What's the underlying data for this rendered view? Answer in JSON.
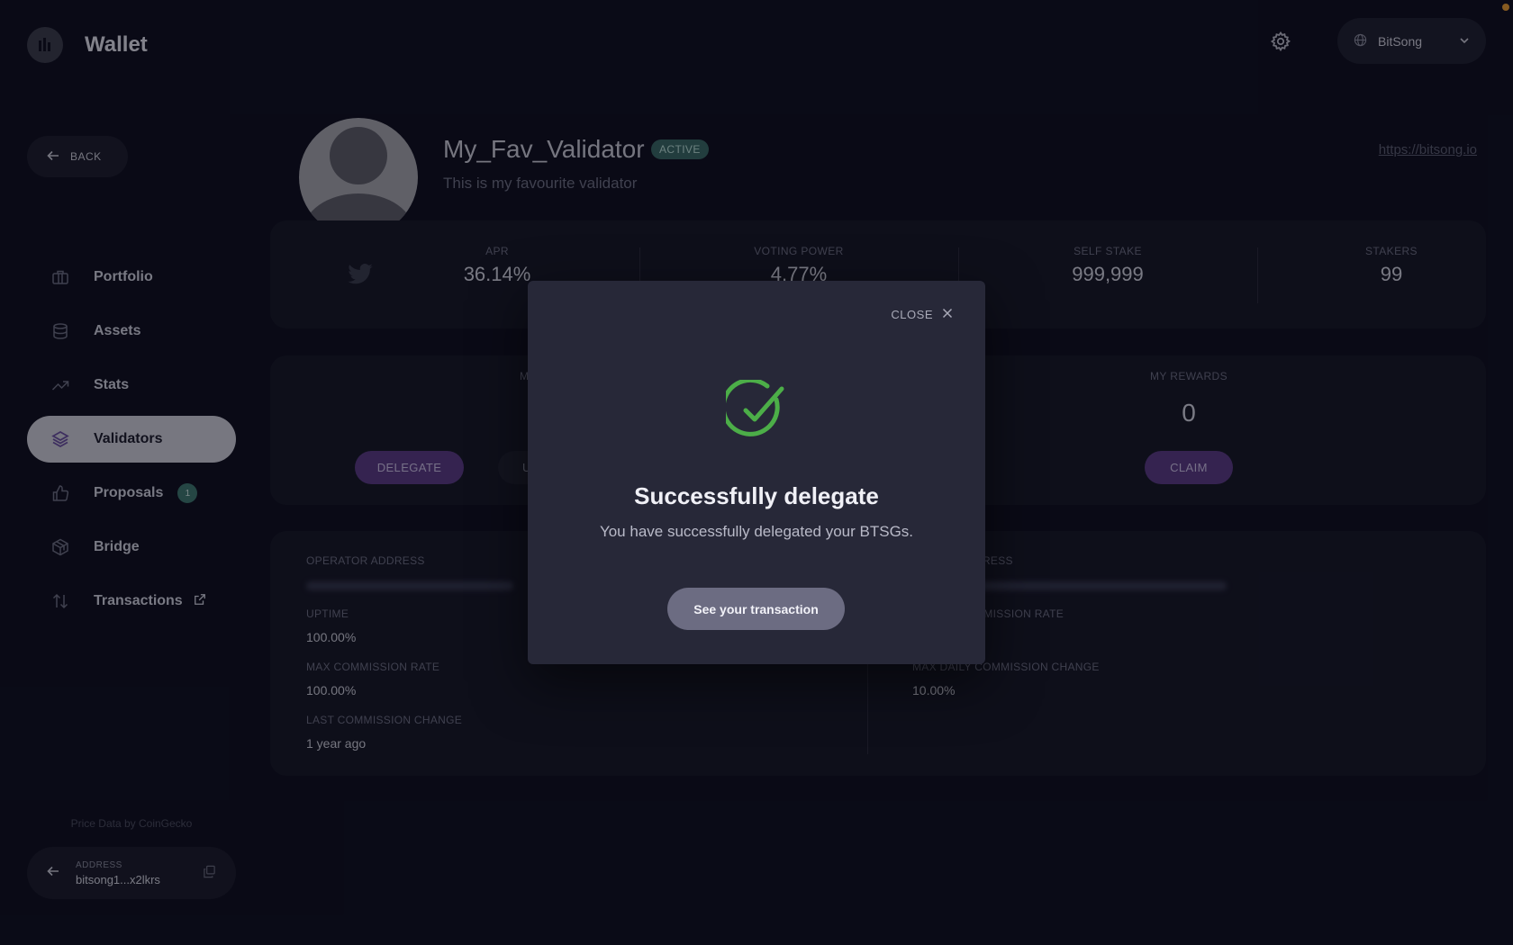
{
  "header": {
    "app_title": "Wallet",
    "network": "BitSong"
  },
  "sidebar": {
    "back_label": "BACK",
    "items": [
      {
        "label": "Portfolio",
        "icon": "briefcase-icon"
      },
      {
        "label": "Assets",
        "icon": "database-icon"
      },
      {
        "label": "Stats",
        "icon": "trending-up-icon"
      },
      {
        "label": "Validators",
        "icon": "layers-icon",
        "active": true
      },
      {
        "label": "Proposals",
        "icon": "thumbs-up-icon",
        "badge": "1"
      },
      {
        "label": "Bridge",
        "icon": "bridge-icon"
      },
      {
        "label": "Transactions",
        "icon": "arrows-icon",
        "external": true
      }
    ],
    "price_data": "Price Data by CoinGecko",
    "address_label": "ADDRESS",
    "address_value": "bitsong1...x2lkrs"
  },
  "validator": {
    "name": "My_Fav_Validator",
    "status": "ACTIVE",
    "description": "This is my favourite validator",
    "website": "https://bitsong.io"
  },
  "stats": {
    "apr_label": "APR",
    "apr_value": "36.14%",
    "voting_power_label": "VOTING POWER",
    "voting_power_value": "4.77%",
    "self_stake_label": "SELF STAKE",
    "self_stake_value": "999,999",
    "stakers_label": "STAKERS",
    "stakers_value": "99"
  },
  "delegation": {
    "my_label_partial": "M",
    "delegate_label": "DELEGATE",
    "undelegate_partial": "U",
    "my_rewards_label": "MY REWARDS",
    "my_rewards_value": "0",
    "claim_label": "CLAIM"
  },
  "info": {
    "operator_address_label": "OPERATOR ADDRESS",
    "uptime_label": "UPTIME",
    "uptime_value": "100.00%",
    "max_commission_label": "MAX COMMISSION RATE",
    "max_commission_value": "100.00%",
    "last_commission_change_label": "LAST COMMISSION CHANGE",
    "last_commission_change_value": "1 year ago",
    "right_address_label_partial": "DRESS",
    "commission_rate_label_partial": "MMISSION RATE",
    "max_daily_change_label": "MAX DAILY COMMISSION CHANGE",
    "max_daily_change_value": "10.00%"
  },
  "modal": {
    "close_label": "CLOSE",
    "title": "Successfully delegate",
    "subtitle": "You have successfully delegated your BTSGs.",
    "button_label": "See your transaction",
    "success_color": "#4cae48"
  }
}
